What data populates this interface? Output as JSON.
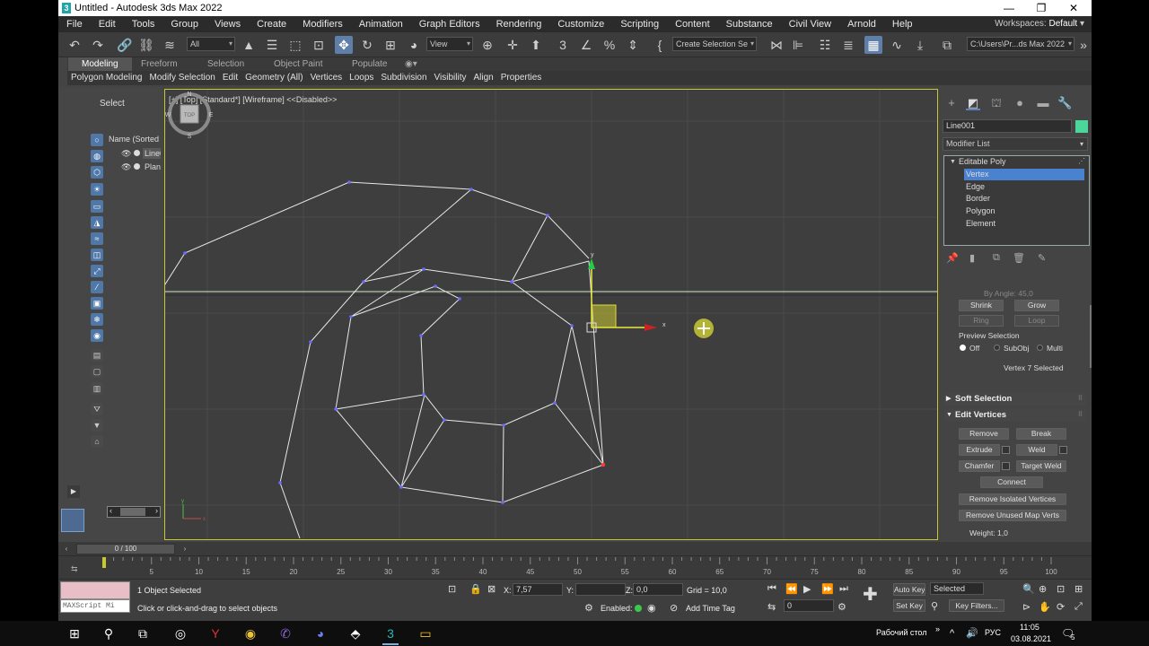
{
  "window": {
    "title": "Untitled - Autodesk 3ds Max 2022",
    "app_icon": "3",
    "min": "—",
    "max": "❐",
    "close": "✕"
  },
  "menu": [
    "File",
    "Edit",
    "Tools",
    "Group",
    "Views",
    "Create",
    "Modifiers",
    "Animation",
    "Graph Editors",
    "Rendering",
    "Customize",
    "Scripting",
    "Content",
    "Substance",
    "Civil View",
    "Arnold",
    "Help"
  ],
  "workspaces": {
    "label": "Workspaces:",
    "value": "Default"
  },
  "toolbar": {
    "filter": "All",
    "ref_coord": "View",
    "named_selection": "Create Selection Se",
    "project_path": "C:\\Users\\Pr...ds Max 2022"
  },
  "ribbon": {
    "tabs": [
      "Modeling",
      "Freeform",
      "Selection",
      "Object Paint",
      "Populate"
    ],
    "active_tab": "Modeling",
    "items": [
      "Polygon Modeling",
      "Modify Selection",
      "Edit",
      "Geometry (All)",
      "Vertices",
      "Loops",
      "Subdivision",
      "Visibility",
      "Align",
      "Properties"
    ]
  },
  "scene_explorer": {
    "select_label": "Select",
    "header": "Name (Sorted A",
    "rows": [
      {
        "name": "Line001",
        "selected": true
      },
      {
        "name": "Plane",
        "selected": false
      }
    ]
  },
  "viewport": {
    "label": "[+] [Top] [Standard*] [Wireframe]  <<Disabled>>",
    "gizmo_x": "x",
    "gizmo_y": "y",
    "cube_face": "TOP",
    "cube_n": "N",
    "cube_s": "S",
    "cube_e": "E",
    "cube_w": "W",
    "line_color": "#e8e8e8",
    "vertex_color": "#6a6aff",
    "border_color": "#c8c832"
  },
  "command_panel": {
    "object_name": "Line001",
    "object_color": "#4bd69a",
    "modifier_list": "Modifier List",
    "stack": {
      "base": "Editable Poly",
      "sub": [
        "Vertex",
        "Edge",
        "Border",
        "Polygon",
        "Element"
      ],
      "selected": "Vertex"
    },
    "by_angle": "By Angle:  45,0",
    "shrink": "Shrink",
    "grow": "Grow",
    "ring": "Ring",
    "loop": "Loop",
    "preview_selection": "Preview Selection",
    "preview_options": [
      "Off",
      "SubObj",
      "Multi"
    ],
    "preview_selected": "Off",
    "selection_status": "Vertex 7 Selected",
    "soft_selection": "Soft Selection",
    "edit_vertices": "Edit Vertices",
    "remove": "Remove",
    "break": "Break",
    "extrude": "Extrude",
    "weld": "Weld",
    "chamfer": "Chamfer",
    "target_weld": "Target Weld",
    "connect": "Connect",
    "remove_isolated": "Remove Isolated Vertices",
    "remove_unused": "Remove Unused Map Verts",
    "weight": "Weight:  1,0"
  },
  "timeline": {
    "frame_display": "0 / 100",
    "ticks": [
      5,
      10,
      15,
      20,
      25,
      30,
      35,
      40,
      45,
      50,
      55,
      60,
      65,
      70,
      75,
      80,
      85,
      90,
      95,
      100
    ],
    "start": 0,
    "end": 100,
    "current": 0
  },
  "status": {
    "maxscript": "MAXScript Mi",
    "objects_selected": "1 Object Selected",
    "prompt": "Click or click-and-drag to select objects",
    "x_label": "X:",
    "x_value": "7,57",
    "y_label": "Y:",
    "y_value": "",
    "z_label": "Z:",
    "z_value": "0,0",
    "grid": "Grid = 10,0",
    "enabled": "Enabled:",
    "add_time_tag": "Add Time Tag",
    "auto_key": "Auto Key",
    "set_key": "Set Key",
    "selected_set": "Selected",
    "key_filters": "Key Filters...",
    "frame_field": "0"
  },
  "taskbar": {
    "desktop_label": "Рабочий стол",
    "lang": "РУС",
    "time": "11:05",
    "date": "03.08.2021",
    "notif_count": "5"
  }
}
